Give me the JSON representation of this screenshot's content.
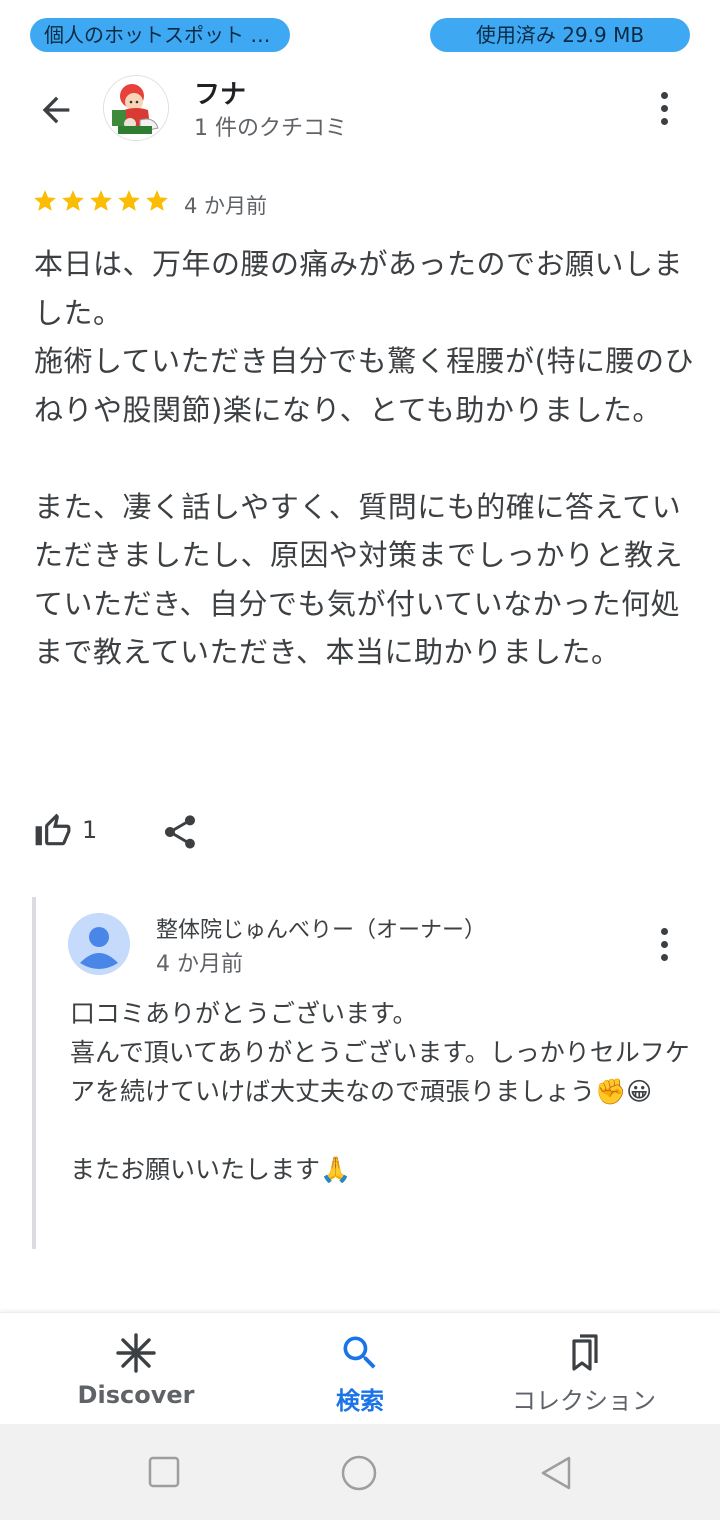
{
  "status_bar": {
    "hotspot_text": "個人のホットスポット : 接続中",
    "data_usage": "使用済み 29.9 MB"
  },
  "header": {
    "back_icon": "arrow-left-icon",
    "reviewer_name": "フナ",
    "review_count": "1 件のクチコミ",
    "more_icon": "more-vert-icon"
  },
  "review": {
    "rating": 5,
    "max_rating": 5,
    "star_color": "#fbbc04",
    "time": "4 か月前",
    "text": "本日は、万年の腰の痛みがあったのでお願いしました。\n施術していただき自分でも驚く程腰が(特に腰のひねりや股関節)楽になり、とても助かりました。\n\nまた、凄く話しやすく、質問にも的確に答えていただきましたし、原因や対策までしっかりと教えていただき、自分でも気が付いていなかった何処まで教えていただき、本当に助かりました。",
    "like_count": "1",
    "like_icon": "thumb-up-icon",
    "share_icon": "share-icon"
  },
  "owner_reply": {
    "name": "整体院じゅんべりー（オーナー）",
    "time": "4 か月前",
    "text": "口コミありがとうございます。\n喜んで頂いてありがとうございます。しっかりセルフケアを続けていけば大丈夫なので頑張りましょう✊😀\n\nまたお願いいたします🙏",
    "more_icon": "more-vert-icon"
  },
  "bottom_nav": {
    "items": [
      {
        "label": "Discover",
        "icon": "asterisk-icon",
        "active": false
      },
      {
        "label": "検索",
        "icon": "search-icon",
        "active": true
      },
      {
        "label": "コレクション",
        "icon": "bookmarks-icon",
        "active": false
      }
    ],
    "active_color": "#1a73e8"
  },
  "system_nav": {
    "buttons": [
      "recents-square-icon",
      "home-circle-icon",
      "back-triangle-icon"
    ]
  }
}
